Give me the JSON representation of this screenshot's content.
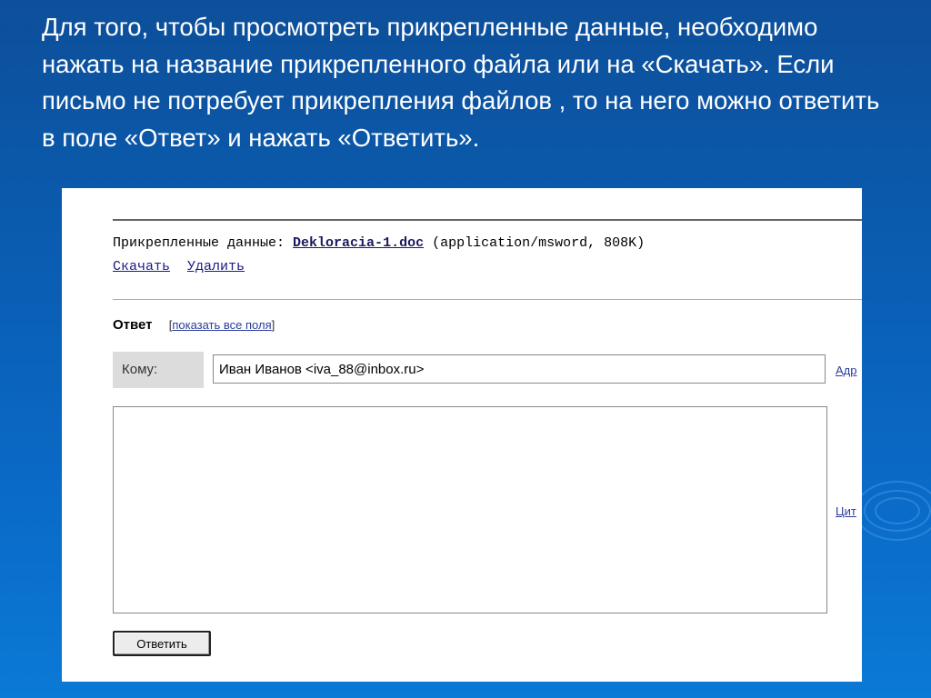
{
  "slide": {
    "text": "Для того, чтобы просмотреть прикрепленные данные, необходимо нажать на название прикрепленного файла или на «Скачать». Если письмо не потребует прикрепления файлов , то на него можно ответить в поле «Ответ» и нажать «Ответить»."
  },
  "attachment": {
    "label": "Прикрепленные данные:",
    "file_name": "Dekloracia-1.doc",
    "file_info": "(application/msword, 808K)",
    "download_link": "Скачать",
    "delete_link": "Удалить"
  },
  "reply": {
    "title": "Ответ",
    "bracket_open": "[",
    "show_all_fields": "показать все поля",
    "bracket_close": "]",
    "to_label": "Кому:",
    "to_value": "Иван Иванов <iva_88@inbox.ru>",
    "address_link_partial": "Адр",
    "quote_link_partial": "Цит",
    "body_value": "",
    "send_button": "Ответить"
  }
}
